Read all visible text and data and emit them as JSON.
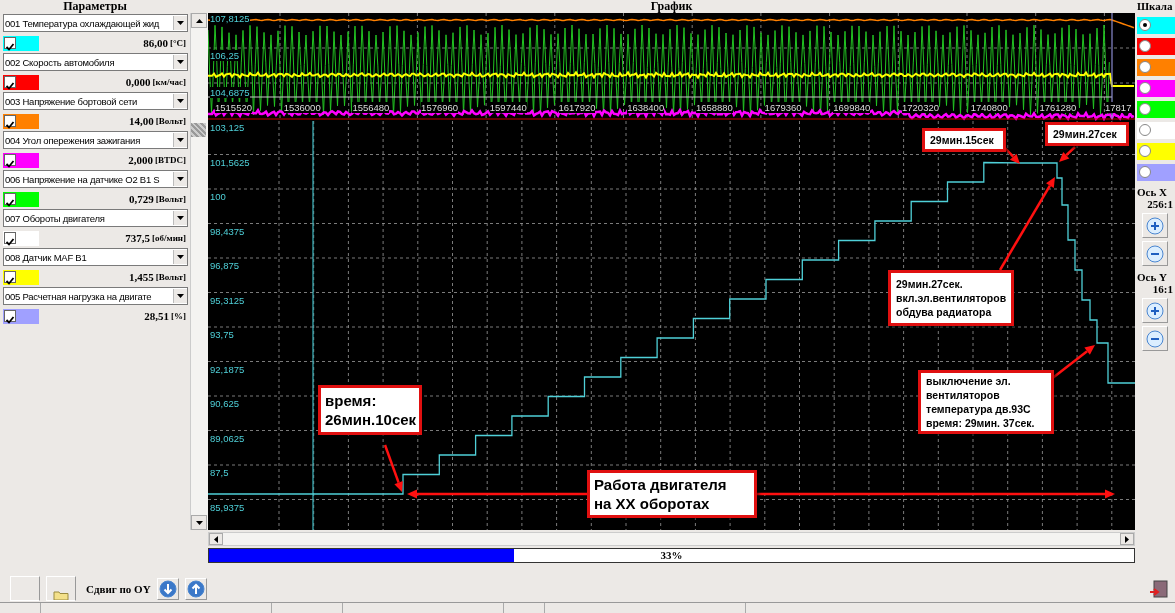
{
  "titles": {
    "parameters": "Параметры",
    "chart": "График",
    "scale": "Шкала"
  },
  "parameters": [
    {
      "name": "001 Температура охлаждающей жид",
      "checked": true,
      "color": "#00ffff",
      "value": "86,00",
      "unit": "[°C]"
    },
    {
      "name": "002 Скорость автомобиля",
      "checked": true,
      "color": "#ff0000",
      "value": "0,000",
      "unit": "[км/час]"
    },
    {
      "name": "003 Напряжение бортовой сети",
      "checked": true,
      "color": "#ff8000",
      "value": "14,00",
      "unit": "[Вольт]"
    },
    {
      "name": "004 Угол опережения зажигания",
      "checked": true,
      "color": "#ff00ff",
      "value": "2,000",
      "unit": "[BTDC]"
    },
    {
      "name": "006 Напряжение на датчике O2 B1 S",
      "checked": true,
      "color": "#00ff00",
      "value": "0,729",
      "unit": "[Вольт]"
    },
    {
      "name": "007 Обороты двигателя",
      "checked": true,
      "color": "#ffffff",
      "value": "737,5",
      "unit": "[об/мин]"
    },
    {
      "name": "008 Датчик MAF B1",
      "checked": true,
      "color": "#ffff00",
      "value": "1,455",
      "unit": "[Вольт]"
    },
    {
      "name": "005 Расчетная нагрузка на двигате",
      "checked": true,
      "color": "#a0a0ff",
      "value": "28,51",
      "unit": "[%]"
    }
  ],
  "scales": [
    {
      "color": "#00ffff",
      "selected": true
    },
    {
      "color": "#ff0000",
      "selected": false
    },
    {
      "color": "#ff8000",
      "selected": false
    },
    {
      "color": "#ff00ff",
      "selected": false
    },
    {
      "color": "#00ff00",
      "selected": false
    },
    {
      "color": "#ffffff",
      "selected": false
    },
    {
      "color": "#ffff00",
      "selected": false
    },
    {
      "color": "#a0a0ff",
      "selected": false
    }
  ],
  "chart": {
    "top_y_labels": [
      "107,8125",
      "106,25",
      "104,6875"
    ],
    "x_labels": [
      "1515520",
      "1536000",
      "1556480",
      "1576960",
      "1597440",
      "1617920",
      "1638400",
      "1658880",
      "1679360",
      "1699840",
      "1720320",
      "1740800",
      "1761280",
      "17817"
    ],
    "main_y_labels": [
      "103,125",
      "101,5625",
      "100",
      "98,4375",
      "96,875",
      "95,3125",
      "93,75",
      "92,1875",
      "90,625",
      "89,0625",
      "87,5",
      "85,9375"
    ]
  },
  "annotations": [
    {
      "text": "время:\n26мин.10сек"
    },
    {
      "text": "Работа двигателя\nна ХХ оборотах"
    },
    {
      "text": "29мин.15сек"
    },
    {
      "text": "29мин.27сек"
    },
    {
      "text": "29мин.27сек.\nвкл.эл.вентиляторов\nобдува радиатора"
    },
    {
      "text": "выключение эл.\nвентиляторов\nтемпература дв.93С\nвремя: 29мин. 37сек."
    }
  ],
  "axis_x": {
    "label": "Ось X",
    "ratio": "256:1"
  },
  "axis_y": {
    "label": "Ось Y",
    "ratio": "16:1"
  },
  "progress": {
    "level": 0.33,
    "reading": "33%"
  },
  "toolbar": {
    "shift_label": "Сдвиг по OY"
  }
}
